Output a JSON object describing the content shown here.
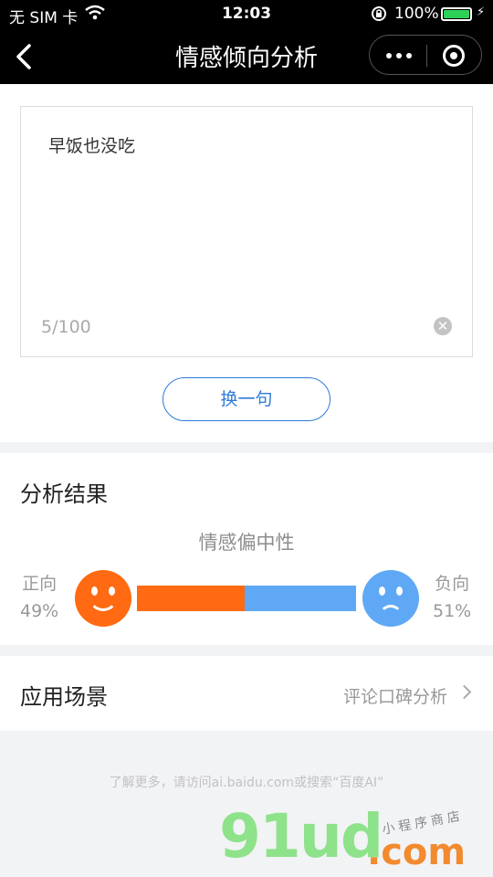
{
  "status_bar": {
    "carrier": "无 SIM 卡",
    "time": "12:03",
    "battery": "100%"
  },
  "nav": {
    "title": "情感倾向分析"
  },
  "input": {
    "text": "早饭也没吃",
    "counter": "5/100",
    "switch_label": "换一句"
  },
  "result": {
    "heading": "分析结果",
    "verdict": "情感偏中性",
    "positive": {
      "label": "正向",
      "percent": "49%"
    },
    "negative": {
      "label": "负向",
      "percent": "51%"
    },
    "positive_fraction": 0.49,
    "colors": {
      "positive": "#ff6a12",
      "negative": "#5fa8f5"
    }
  },
  "scene": {
    "label": "应用场景",
    "value": "评论口碑分析"
  },
  "footer": {
    "note": "了解更多，请访问ai.baidu.com或搜索“百度AI”"
  },
  "watermark": {
    "brand": "91ud",
    "domain": ".com",
    "tagline": "小程序商店"
  }
}
